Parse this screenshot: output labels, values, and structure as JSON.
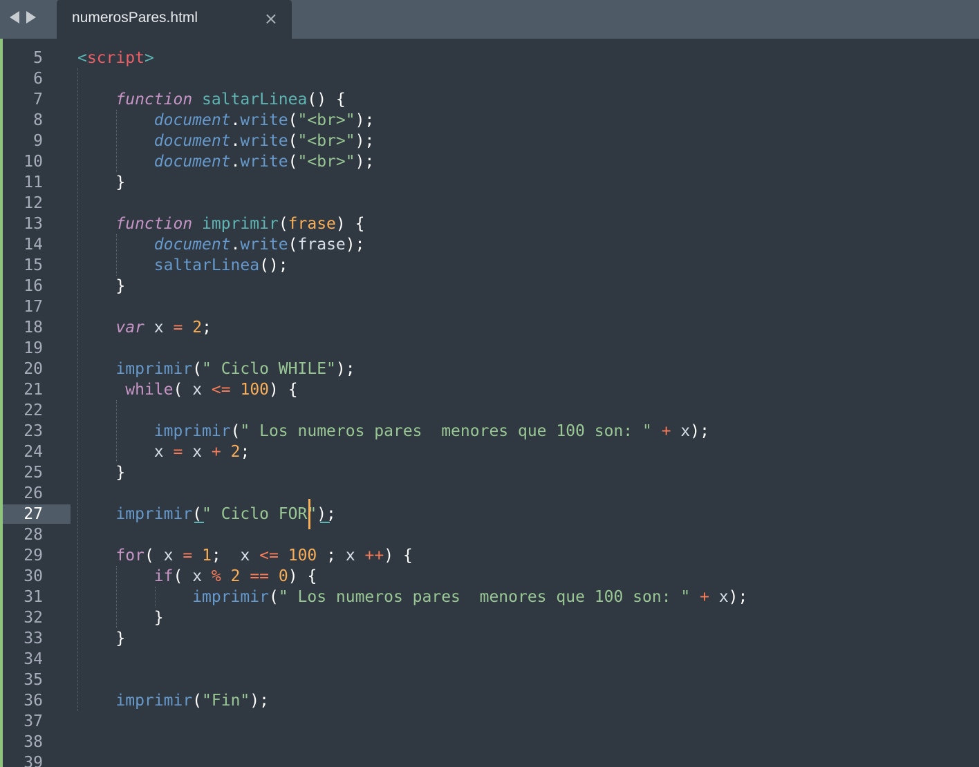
{
  "tab": {
    "title": "numerosPares.html",
    "close_glyph": "×"
  },
  "nav": {
    "back_icon": "chevron-left-icon",
    "forward_icon": "chevron-right-icon"
  },
  "editor": {
    "current_line": 27,
    "colors": {
      "background": "#303841",
      "tabbar": "#4e5a65",
      "modified_indicator": "#8fc47c",
      "caret": "#f9ae58"
    },
    "lines": [
      {
        "n": "5",
        "tokens": [
          [
            "t-tag",
            "<"
          ],
          [
            "t-tagname",
            "script"
          ],
          [
            "t-tag",
            ">"
          ]
        ]
      },
      {
        "n": "6",
        "tokens": []
      },
      {
        "n": "7",
        "tokens": [
          [
            "t-plain",
            "    "
          ],
          [
            "t-keyword",
            "function"
          ],
          [
            "t-plain",
            " "
          ],
          [
            "t-fn",
            "saltarLinea"
          ],
          [
            "t-punct",
            "() {"
          ]
        ]
      },
      {
        "n": "8",
        "tokens": [
          [
            "t-plain",
            "        "
          ],
          [
            "t-obj",
            "document"
          ],
          [
            "t-punct",
            "."
          ],
          [
            "t-call",
            "write"
          ],
          [
            "t-punct",
            "("
          ],
          [
            "t-string",
            "\"<br>\""
          ],
          [
            "t-punct",
            ");"
          ]
        ]
      },
      {
        "n": "9",
        "tokens": [
          [
            "t-plain",
            "        "
          ],
          [
            "t-obj",
            "document"
          ],
          [
            "t-punct",
            "."
          ],
          [
            "t-call",
            "write"
          ],
          [
            "t-punct",
            "("
          ],
          [
            "t-string",
            "\"<br>\""
          ],
          [
            "t-punct",
            ");"
          ]
        ]
      },
      {
        "n": "10",
        "tokens": [
          [
            "t-plain",
            "        "
          ],
          [
            "t-obj",
            "document"
          ],
          [
            "t-punct",
            "."
          ],
          [
            "t-call",
            "write"
          ],
          [
            "t-punct",
            "("
          ],
          [
            "t-string",
            "\"<br>\""
          ],
          [
            "t-punct",
            ");"
          ]
        ]
      },
      {
        "n": "11",
        "tokens": [
          [
            "t-plain",
            "    "
          ],
          [
            "t-punct",
            "}"
          ]
        ]
      },
      {
        "n": "12",
        "tokens": []
      },
      {
        "n": "13",
        "tokens": [
          [
            "t-plain",
            "    "
          ],
          [
            "t-keyword",
            "function"
          ],
          [
            "t-plain",
            " "
          ],
          [
            "t-fn",
            "imprimir"
          ],
          [
            "t-punct",
            "("
          ],
          [
            "t-param",
            "frase"
          ],
          [
            "t-punct",
            ") {"
          ]
        ]
      },
      {
        "n": "14",
        "tokens": [
          [
            "t-plain",
            "        "
          ],
          [
            "t-obj",
            "document"
          ],
          [
            "t-punct",
            "."
          ],
          [
            "t-call",
            "write"
          ],
          [
            "t-punct",
            "("
          ],
          [
            "t-plain",
            "frase"
          ],
          [
            "t-punct",
            ");"
          ]
        ]
      },
      {
        "n": "15",
        "tokens": [
          [
            "t-plain",
            "        "
          ],
          [
            "t-call",
            "saltarLinea"
          ],
          [
            "t-punct",
            "();"
          ]
        ]
      },
      {
        "n": "16",
        "tokens": [
          [
            "t-plain",
            "    "
          ],
          [
            "t-punct",
            "}"
          ]
        ]
      },
      {
        "n": "17",
        "tokens": []
      },
      {
        "n": "18",
        "tokens": [
          [
            "t-plain",
            "    "
          ],
          [
            "t-keyword",
            "var"
          ],
          [
            "t-plain",
            " x "
          ],
          [
            "t-op",
            "="
          ],
          [
            "t-plain",
            " "
          ],
          [
            "t-num",
            "2"
          ],
          [
            "t-punct",
            ";"
          ]
        ]
      },
      {
        "n": "19",
        "tokens": []
      },
      {
        "n": "20",
        "tokens": [
          [
            "t-plain",
            "    "
          ],
          [
            "t-call",
            "imprimir"
          ],
          [
            "t-punct",
            "("
          ],
          [
            "t-string",
            "\" Ciclo WHILE\""
          ],
          [
            "t-punct",
            ");"
          ]
        ]
      },
      {
        "n": "21",
        "tokens": [
          [
            "t-plain",
            "     "
          ],
          [
            "t-control",
            "while"
          ],
          [
            "t-punct",
            "("
          ],
          [
            "t-plain",
            " x "
          ],
          [
            "t-op",
            "<="
          ],
          [
            "t-plain",
            " "
          ],
          [
            "t-num",
            "100"
          ],
          [
            "t-punct",
            ") {"
          ]
        ]
      },
      {
        "n": "22",
        "tokens": []
      },
      {
        "n": "23",
        "tokens": [
          [
            "t-plain",
            "        "
          ],
          [
            "t-call",
            "imprimir"
          ],
          [
            "t-punct",
            "("
          ],
          [
            "t-string",
            "\" Los numeros pares  menores que 100 son: \""
          ],
          [
            "t-plain",
            " "
          ],
          [
            "t-op",
            "+"
          ],
          [
            "t-plain",
            " x"
          ],
          [
            "t-punct",
            ");"
          ]
        ]
      },
      {
        "n": "24",
        "tokens": [
          [
            "t-plain",
            "        x "
          ],
          [
            "t-op",
            "="
          ],
          [
            "t-plain",
            " x "
          ],
          [
            "t-op",
            "+"
          ],
          [
            "t-plain",
            " "
          ],
          [
            "t-num",
            "2"
          ],
          [
            "t-punct",
            ";"
          ]
        ]
      },
      {
        "n": "25",
        "tokens": [
          [
            "t-plain",
            "    "
          ],
          [
            "t-punct",
            "}"
          ]
        ]
      },
      {
        "n": "26",
        "tokens": []
      },
      {
        "n": "27",
        "tokens": [
          [
            "t-plain",
            "    "
          ],
          [
            "t-call",
            "imprimir"
          ],
          [
            "t-punct",
            "("
          ],
          [
            "t-string",
            "\" Ciclo FOR\""
          ],
          [
            "t-punct",
            ");"
          ]
        ]
      },
      {
        "n": "28",
        "tokens": []
      },
      {
        "n": "29",
        "tokens": [
          [
            "t-plain",
            "    "
          ],
          [
            "t-control",
            "for"
          ],
          [
            "t-punct",
            "("
          ],
          [
            "t-plain",
            " x "
          ],
          [
            "t-op",
            "="
          ],
          [
            "t-plain",
            " "
          ],
          [
            "t-num",
            "1"
          ],
          [
            "t-punct",
            ";"
          ],
          [
            "t-plain",
            "  x "
          ],
          [
            "t-op",
            "<="
          ],
          [
            "t-plain",
            " "
          ],
          [
            "t-num",
            "100"
          ],
          [
            "t-plain",
            " "
          ],
          [
            "t-punct",
            ";"
          ],
          [
            "t-plain",
            " x "
          ],
          [
            "t-op",
            "++"
          ],
          [
            "t-punct",
            ") {"
          ]
        ]
      },
      {
        "n": "30",
        "tokens": [
          [
            "t-plain",
            "        "
          ],
          [
            "t-control",
            "if"
          ],
          [
            "t-punct",
            "("
          ],
          [
            "t-plain",
            " x "
          ],
          [
            "t-op",
            "%"
          ],
          [
            "t-plain",
            " "
          ],
          [
            "t-num",
            "2"
          ],
          [
            "t-plain",
            " "
          ],
          [
            "t-op",
            "=="
          ],
          [
            "t-plain",
            " "
          ],
          [
            "t-num",
            "0"
          ],
          [
            "t-punct",
            ") {"
          ]
        ]
      },
      {
        "n": "31",
        "tokens": [
          [
            "t-plain",
            "            "
          ],
          [
            "t-call",
            "imprimir"
          ],
          [
            "t-punct",
            "("
          ],
          [
            "t-string",
            "\" Los numeros pares  menores que 100 son: \""
          ],
          [
            "t-plain",
            " "
          ],
          [
            "t-op",
            "+"
          ],
          [
            "t-plain",
            " x"
          ],
          [
            "t-punct",
            ");"
          ]
        ]
      },
      {
        "n": "32",
        "tokens": [
          [
            "t-plain",
            "        "
          ],
          [
            "t-punct",
            "}"
          ]
        ]
      },
      {
        "n": "33",
        "tokens": [
          [
            "t-plain",
            "    "
          ],
          [
            "t-punct",
            "}"
          ]
        ]
      },
      {
        "n": "34",
        "tokens": []
      },
      {
        "n": "35",
        "tokens": []
      },
      {
        "n": "36",
        "tokens": [
          [
            "t-plain",
            "    "
          ],
          [
            "t-call",
            "imprimir"
          ],
          [
            "t-punct",
            "("
          ],
          [
            "t-string",
            "\"Fin\""
          ],
          [
            "t-punct",
            ");"
          ]
        ]
      },
      {
        "n": "37",
        "tokens": []
      },
      {
        "n": "38",
        "tokens": []
      },
      {
        "n": "39",
        "tokens": []
      }
    ]
  }
}
